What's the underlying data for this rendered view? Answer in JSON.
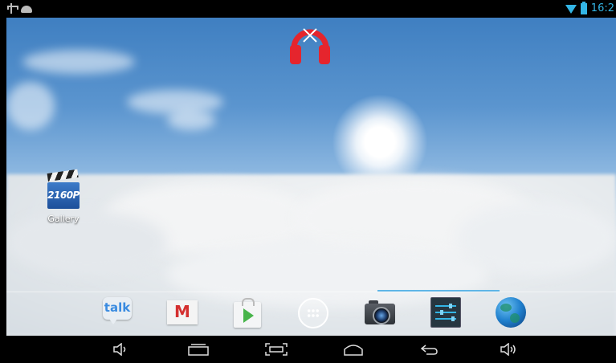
{
  "status_bar": {
    "time": "16:2",
    "left_icons": [
      "usb-icon",
      "android-debug-icon"
    ],
    "right_icons": [
      "wifi-icon",
      "battery-icon"
    ],
    "accent_color": "#33b5e5"
  },
  "home_screen": {
    "widgets": [
      {
        "icon": "play-music-icon",
        "color": "#e5252d"
      }
    ],
    "shortcuts": [
      {
        "label": "Gallery",
        "icon_text": "2160P"
      }
    ]
  },
  "dock": {
    "items": [
      {
        "name": "talk",
        "icon": "talk-icon",
        "icon_text": "talk"
      },
      {
        "name": "gmail",
        "icon": "gmail-icon",
        "icon_text": "M"
      },
      {
        "name": "play-store",
        "icon": "play-store-icon"
      },
      {
        "name": "all-apps",
        "icon": "app-drawer-icon"
      },
      {
        "name": "camera",
        "icon": "camera-icon"
      },
      {
        "name": "settings",
        "icon": "settings-icon"
      },
      {
        "name": "browser",
        "icon": "globe-icon"
      }
    ]
  },
  "nav_bar": {
    "buttons": [
      "volume-down-icon",
      "recent-apps-icon",
      "screenshot-icon",
      "home-icon",
      "back-icon",
      "volume-up-icon"
    ]
  }
}
